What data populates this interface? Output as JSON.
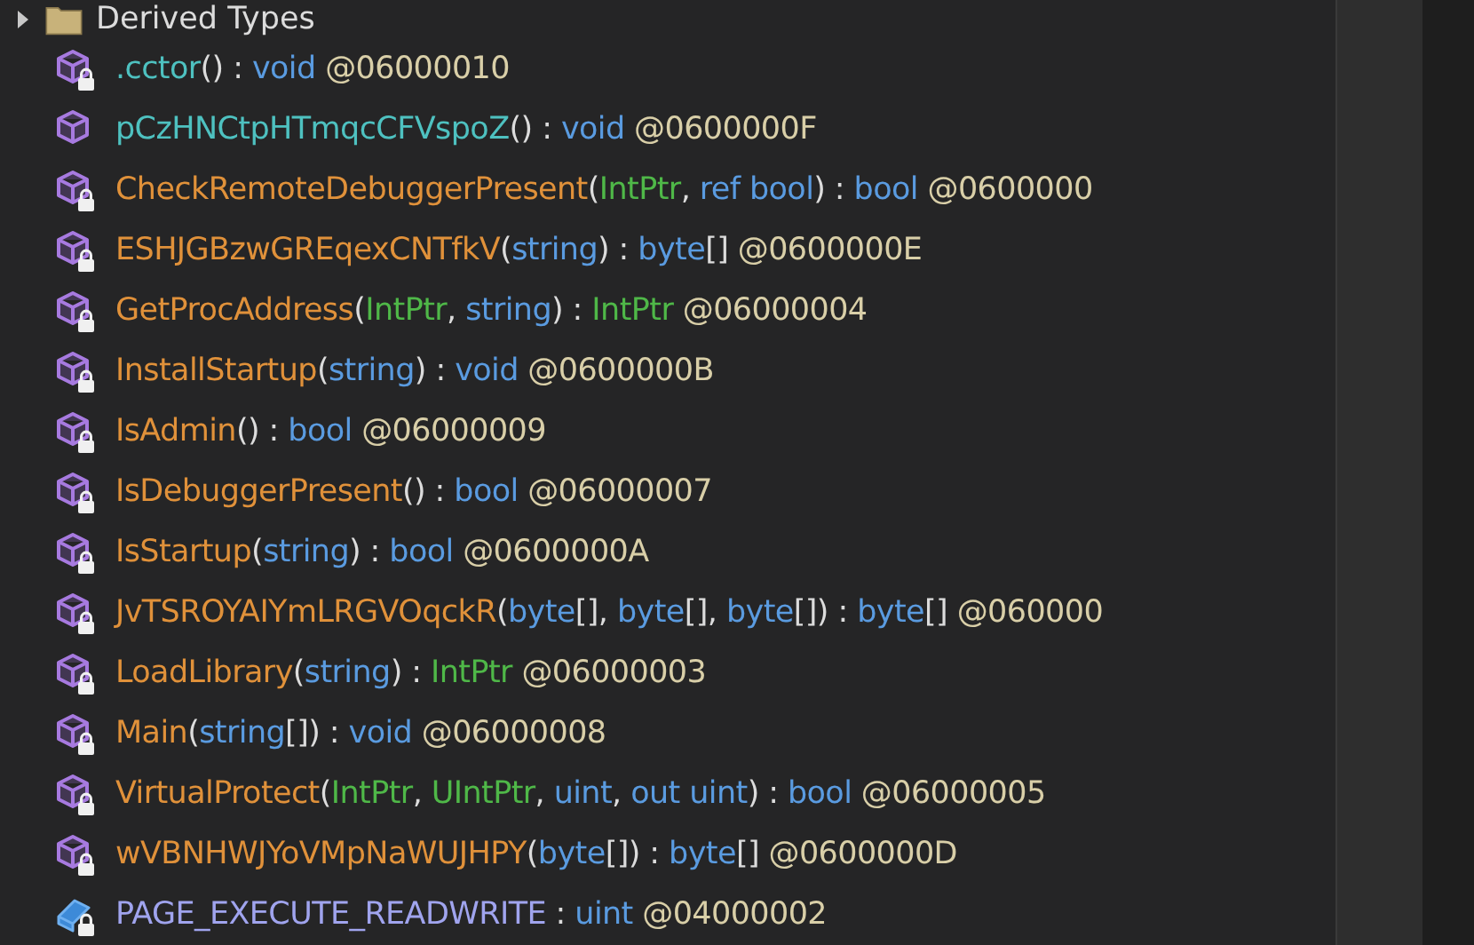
{
  "tree": {
    "header": {
      "label": "Derived Types",
      "expanded": false
    },
    "rows": [
      {
        "kind": "method",
        "locked": true,
        "parts": [
          {
            "text": ".cctor",
            "kind": "instance"
          },
          {
            "text": "() : ",
            "kind": "p"
          },
          {
            "text": "void",
            "kind": "kw"
          },
          {
            "text": " @06000010",
            "kind": "tok"
          }
        ]
      },
      {
        "kind": "method",
        "locked": false,
        "parts": [
          {
            "text": "pCzHNCtpHTmqcCFVspoZ",
            "kind": "instance"
          },
          {
            "text": "() : ",
            "kind": "p"
          },
          {
            "text": "void",
            "kind": "kw"
          },
          {
            "text": " @0600000F",
            "kind": "tok"
          }
        ]
      },
      {
        "kind": "method",
        "locked": true,
        "parts": [
          {
            "text": "CheckRemoteDebuggerPresent",
            "kind": "static"
          },
          {
            "text": "(",
            "kind": "p"
          },
          {
            "text": "IntPtr",
            "kind": "cls"
          },
          {
            "text": ", ",
            "kind": "p"
          },
          {
            "text": "ref bool",
            "kind": "kw"
          },
          {
            "text": ") : ",
            "kind": "p"
          },
          {
            "text": "bool",
            "kind": "kw"
          },
          {
            "text": " @0600000",
            "kind": "tok"
          }
        ]
      },
      {
        "kind": "method",
        "locked": true,
        "parts": [
          {
            "text": "ESHJGBzwGREqexCNTfkV",
            "kind": "static"
          },
          {
            "text": "(",
            "kind": "p"
          },
          {
            "text": "string",
            "kind": "kw"
          },
          {
            "text": ") : ",
            "kind": "p"
          },
          {
            "text": "byte",
            "kind": "kw"
          },
          {
            "text": "[]",
            "kind": "p"
          },
          {
            "text": " @0600000E",
            "kind": "tok"
          }
        ]
      },
      {
        "kind": "method",
        "locked": true,
        "parts": [
          {
            "text": "GetProcAddress",
            "kind": "static"
          },
          {
            "text": "(",
            "kind": "p"
          },
          {
            "text": "IntPtr",
            "kind": "cls"
          },
          {
            "text": ", ",
            "kind": "p"
          },
          {
            "text": "string",
            "kind": "kw"
          },
          {
            "text": ") : ",
            "kind": "p"
          },
          {
            "text": "IntPtr",
            "kind": "cls"
          },
          {
            "text": " @06000004",
            "kind": "tok"
          }
        ]
      },
      {
        "kind": "method",
        "locked": true,
        "parts": [
          {
            "text": "InstallStartup",
            "kind": "static"
          },
          {
            "text": "(",
            "kind": "p"
          },
          {
            "text": "string",
            "kind": "kw"
          },
          {
            "text": ") : ",
            "kind": "p"
          },
          {
            "text": "void",
            "kind": "kw"
          },
          {
            "text": " @0600000B",
            "kind": "tok"
          }
        ]
      },
      {
        "kind": "method",
        "locked": true,
        "parts": [
          {
            "text": "IsAdmin",
            "kind": "static"
          },
          {
            "text": "() : ",
            "kind": "p"
          },
          {
            "text": "bool",
            "kind": "kw"
          },
          {
            "text": " @06000009",
            "kind": "tok"
          }
        ]
      },
      {
        "kind": "method",
        "locked": true,
        "parts": [
          {
            "text": "IsDebuggerPresent",
            "kind": "static"
          },
          {
            "text": "() : ",
            "kind": "p"
          },
          {
            "text": "bool",
            "kind": "kw"
          },
          {
            "text": " @06000007",
            "kind": "tok"
          }
        ]
      },
      {
        "kind": "method",
        "locked": true,
        "parts": [
          {
            "text": "IsStartup",
            "kind": "static"
          },
          {
            "text": "(",
            "kind": "p"
          },
          {
            "text": "string",
            "kind": "kw"
          },
          {
            "text": ") : ",
            "kind": "p"
          },
          {
            "text": "bool",
            "kind": "kw"
          },
          {
            "text": " @0600000A",
            "kind": "tok"
          }
        ]
      },
      {
        "kind": "method",
        "locked": true,
        "parts": [
          {
            "text": "JvTSROYAIYmLRGVOqckR",
            "kind": "static"
          },
          {
            "text": "(",
            "kind": "p"
          },
          {
            "text": "byte",
            "kind": "kw"
          },
          {
            "text": "[], ",
            "kind": "p"
          },
          {
            "text": "byte",
            "kind": "kw"
          },
          {
            "text": "[], ",
            "kind": "p"
          },
          {
            "text": "byte",
            "kind": "kw"
          },
          {
            "text": "[]) : ",
            "kind": "p"
          },
          {
            "text": "byte",
            "kind": "kw"
          },
          {
            "text": "[]",
            "kind": "p"
          },
          {
            "text": " @060000",
            "kind": "tok"
          }
        ]
      },
      {
        "kind": "method",
        "locked": true,
        "parts": [
          {
            "text": "LoadLibrary",
            "kind": "static"
          },
          {
            "text": "(",
            "kind": "p"
          },
          {
            "text": "string",
            "kind": "kw"
          },
          {
            "text": ") : ",
            "kind": "p"
          },
          {
            "text": "IntPtr",
            "kind": "cls"
          },
          {
            "text": " @06000003",
            "kind": "tok"
          }
        ]
      },
      {
        "kind": "method",
        "locked": true,
        "parts": [
          {
            "text": "Main",
            "kind": "static"
          },
          {
            "text": "(",
            "kind": "p"
          },
          {
            "text": "string",
            "kind": "kw"
          },
          {
            "text": "[]) : ",
            "kind": "p"
          },
          {
            "text": "void",
            "kind": "kw"
          },
          {
            "text": " @06000008",
            "kind": "tok"
          }
        ]
      },
      {
        "kind": "method",
        "locked": true,
        "parts": [
          {
            "text": "VirtualProtect",
            "kind": "static"
          },
          {
            "text": "(",
            "kind": "p"
          },
          {
            "text": "IntPtr",
            "kind": "cls"
          },
          {
            "text": ", ",
            "kind": "p"
          },
          {
            "text": "UIntPtr",
            "kind": "cls"
          },
          {
            "text": ", ",
            "kind": "p"
          },
          {
            "text": "uint",
            "kind": "kw"
          },
          {
            "text": ", ",
            "kind": "p"
          },
          {
            "text": "out uint",
            "kind": "kw"
          },
          {
            "text": ") : ",
            "kind": "p"
          },
          {
            "text": "bool",
            "kind": "kw"
          },
          {
            "text": " @06000005",
            "kind": "tok"
          }
        ]
      },
      {
        "kind": "method",
        "locked": true,
        "parts": [
          {
            "text": "wVBNHWJYoVMpNaWUJHPY",
            "kind": "static"
          },
          {
            "text": "(",
            "kind": "p"
          },
          {
            "text": "byte",
            "kind": "kw"
          },
          {
            "text": "[]) : ",
            "kind": "p"
          },
          {
            "text": "byte",
            "kind": "kw"
          },
          {
            "text": "[]",
            "kind": "p"
          },
          {
            "text": " @0600000D",
            "kind": "tok"
          }
        ]
      },
      {
        "kind": "field",
        "locked": true,
        "parts": [
          {
            "text": "PAGE_EXECUTE_READWRITE",
            "kind": "field"
          },
          {
            "text": " : ",
            "kind": "p"
          },
          {
            "text": "uint",
            "kind": "kw"
          },
          {
            "text": " @04000002",
            "kind": "tok"
          }
        ]
      }
    ]
  }
}
